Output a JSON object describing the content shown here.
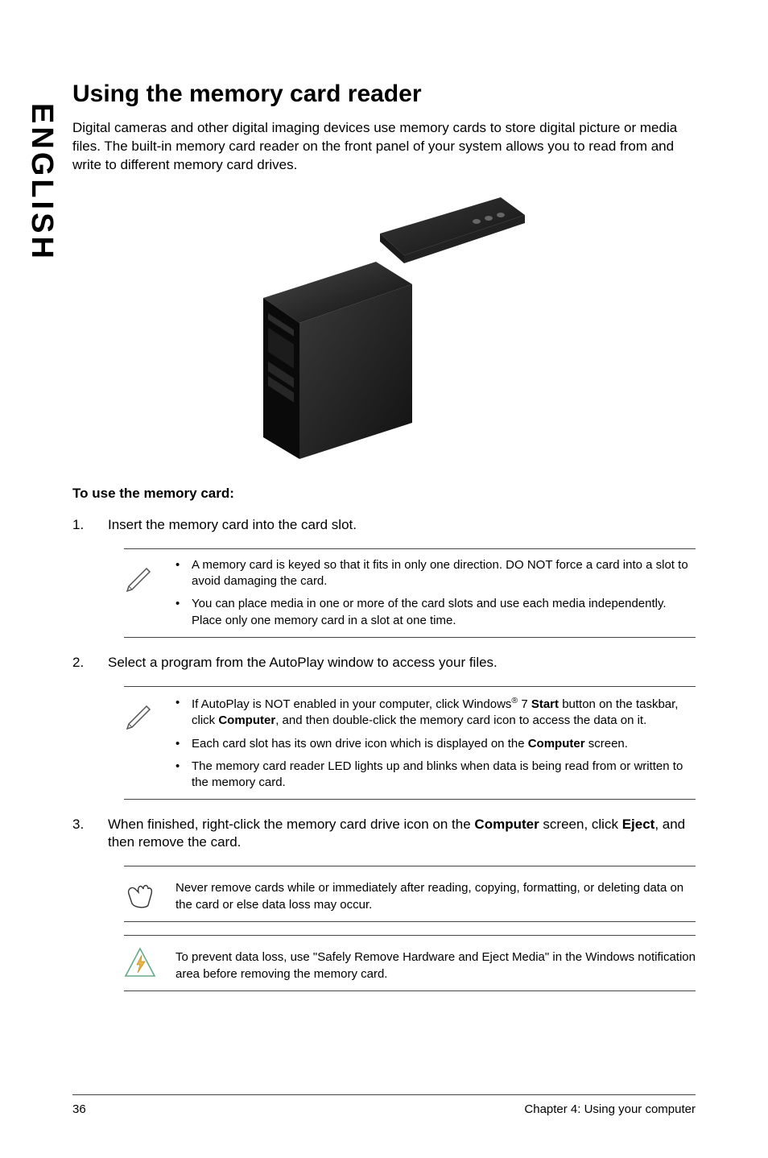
{
  "side_label": "ENGLISH",
  "title": "Using the memory card reader",
  "intro": "Digital cameras and other digital imaging devices use memory cards to store digital picture or media files. The built-in memory card reader on the front panel of your system allows you to read from and write to different memory card drives.",
  "subhead": "To use the memory card:",
  "steps": [
    {
      "num": "1.",
      "text": "Insert the memory card into the card slot."
    },
    {
      "num": "2.",
      "text": "Select a program from the AutoPlay window to access your files."
    },
    {
      "num": "3.",
      "text_pre": "When finished, right-click the memory card drive icon on the ",
      "bold1": "Computer",
      "text_mid": " screen, click ",
      "bold2": "Eject",
      "text_post": ", and then remove the card."
    }
  ],
  "note1": {
    "bullets": [
      "A memory card is keyed so that it fits in only one direction. DO NOT force a card into a slot to avoid damaging the card.",
      "You can place media in one or more of the card slots and use each media independently. Place only one memory card in a slot at one time."
    ]
  },
  "note2": {
    "b1_pre": "If AutoPlay is NOT enabled in your computer, click Windows",
    "b1_sup": "®",
    "b1_mid1": " 7 ",
    "b1_bold1": "Start",
    "b1_mid2": " button on the taskbar, click ",
    "b1_bold2": "Computer",
    "b1_post": ", and then double-click the memory card icon to access the data on it.",
    "b2_pre": "Each card slot has its own drive icon which is displayed on the ",
    "b2_bold": "Computer",
    "b2_post": " screen.",
    "b3": "The memory card reader LED lights up and blinks when data is being read from or written to the memory card."
  },
  "note3": "Never remove cards while or immediately after reading, copying, formatting, or deleting data on the card or else data loss may occur.",
  "note4": "To prevent data loss, use \"Safely Remove Hardware and Eject Media\" in the Windows notification area before removing the memory card.",
  "footer_page": "36",
  "footer_chapter": "Chapter 4: Using your computer"
}
